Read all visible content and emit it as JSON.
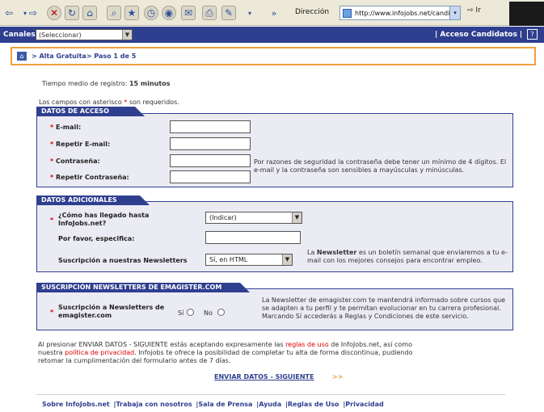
{
  "browser": {
    "address_label": "Dirección",
    "url": "http://www.infojobs.net/candidat",
    "go_label": "Ir",
    "more_label": "»"
  },
  "site": {
    "canales_label": "Canales:",
    "canales_value": "(Seleccionar)",
    "acceso_label": "| Acceso Candidatos |",
    "help_label": "?"
  },
  "breadcrumb": "> Alta Gratuita> Paso 1 de 5",
  "intro": {
    "tiempo_label": "Tiempo medio de registro:",
    "tiempo_value": "15 minutos",
    "required_pre": "Los campos con asterisco",
    "required_star": "*",
    "required_post": "son requeridos."
  },
  "datos_acceso": {
    "title": "DATOS DE ACCESO",
    "email_label": "E-mail:",
    "repetir_email_label": "Repetir E-mail:",
    "password_label": "Contraseña:",
    "repetir_password_label": "Repetir Contraseña:",
    "security_note": "Por razones de seguridad la contraseña debe tener un mínimo de 4 dígitos. El e-mail y la contraseña son sensibles a mayúsculas y minúsculas."
  },
  "datos_adicionales": {
    "title": "DATOS ADICIONALES",
    "como_label": "¿Cómo has llegado hasta InfoJobs.net?",
    "como_value": "(Indicar)",
    "especifica_label": "Por favor, especifica:",
    "newsletter_label": "Suscripción a nuestras Newsletters",
    "newsletter_value": "Sí, en HTML",
    "newsletter_note_pre": "La",
    "newsletter_note_bold": "Newsletter",
    "newsletter_note_post": "es un boletín semanal que enviaremos a tu e-mail con los mejores consejos para encontrar empleo."
  },
  "emagister": {
    "title": "SUSCRIPCIÓN NEWSLETTERS DE EMAGISTER.COM",
    "label": "Suscripción a Newsletters de emagister.com",
    "si_label": "Sí",
    "no_label": "No",
    "note": "La Newsletter de emagister.com te mantendrá informado sobre cursos que se adapten a tu perfil y te permitan evolucionar en tu carrera profesional. Marcando Sí accederás a Reglas y Condiciones de este servicio."
  },
  "legal": {
    "line1_pre": "Al presionar ENVIAR DATOS - SIGUIENTE estás aceptando expresamente las",
    "reglas_link": "reglas de uso",
    "line1_post": "de InfoJobs.net, así como",
    "line2_pre": "nuestra",
    "politica_link": "política de privacidad",
    "line2_post": ". Infojobs te ofrece la posibilidad de completar tu alta de forma discontinua, pudiendo",
    "line3": "retomar la cumplimentación del formulario antes de 7 días."
  },
  "submit_label": "ENVIAR DATOS - SIGUIENTE",
  "submit_arrows": ">>",
  "footer": [
    "Sobre InfoJobs.net",
    "|Trabaja con nosotros",
    "|Sala de Prensa",
    "|Ayuda",
    "|Reglas de Uso",
    "|Privacidad"
  ]
}
